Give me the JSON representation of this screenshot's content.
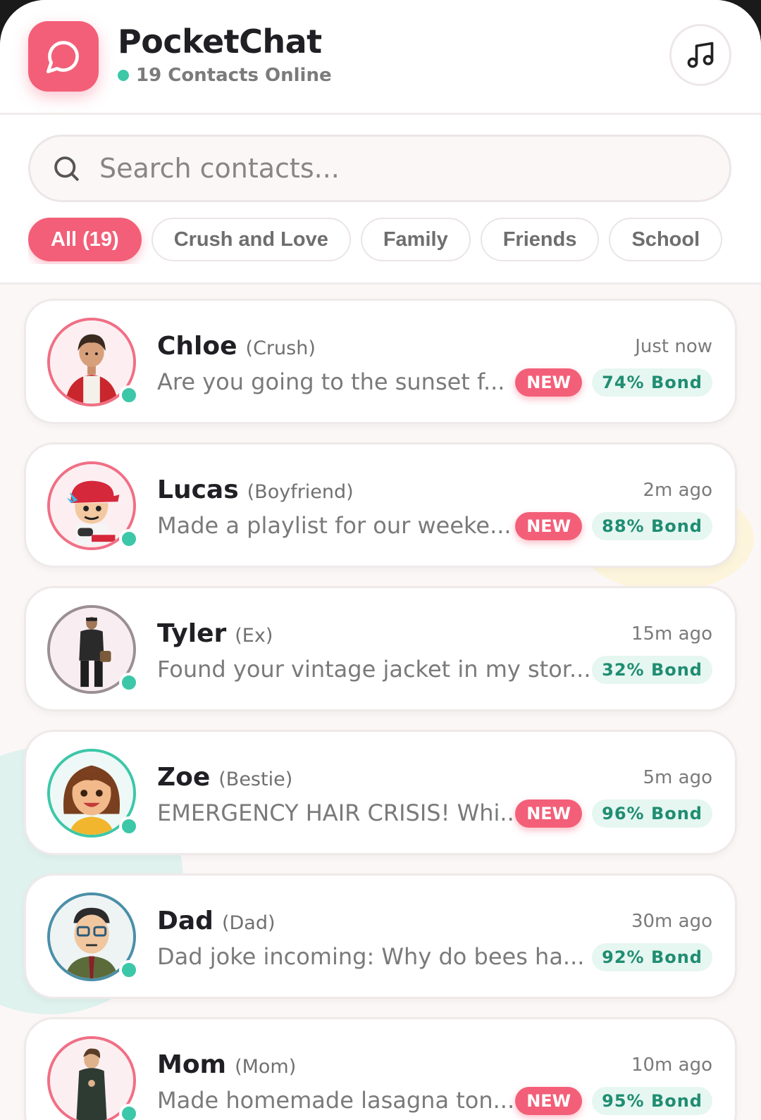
{
  "app": {
    "title": "PocketChat",
    "online_status": "19 Contacts Online"
  },
  "search": {
    "placeholder": "Search contacts..."
  },
  "filters": [
    {
      "label": "All (19)",
      "active": true
    },
    {
      "label": "Crush and Love",
      "active": false
    },
    {
      "label": "Family",
      "active": false
    },
    {
      "label": "Friends",
      "active": false
    },
    {
      "label": "School",
      "active": false
    }
  ],
  "contacts": [
    {
      "name": "Chloe",
      "relation": "(Crush)",
      "time": "Just now",
      "preview": "Are you going to the sunset f...",
      "new_label": "NEW",
      "bond": "74% Bond",
      "online": true,
      "avatar_ring": "#f06f85"
    },
    {
      "name": "Lucas",
      "relation": "(Boyfriend)",
      "time": "2m ago",
      "preview": "Made a playlist for our weeke...",
      "new_label": "NEW",
      "bond": "88% Bond",
      "online": true,
      "avatar_ring": "#f06f85"
    },
    {
      "name": "Tyler",
      "relation": "(Ex)",
      "time": "15m ago",
      "preview": "Found your vintage jacket in my stor...",
      "new_label": "",
      "bond": "32% Bond",
      "online": true,
      "avatar_ring": "#9a8f94"
    },
    {
      "name": "Zoe",
      "relation": "(Bestie)",
      "time": "5m ago",
      "preview": "EMERGENCY HAIR CRISIS! Whi...",
      "new_label": "NEW",
      "bond": "96% Bond",
      "online": true,
      "avatar_ring": "#3cc7a8"
    },
    {
      "name": "Dad",
      "relation": "(Dad)",
      "time": "30m ago",
      "preview": "Dad joke incoming: Why do bees ha...",
      "new_label": "",
      "bond": "92% Bond",
      "online": true,
      "avatar_ring": "#4a8fa8"
    },
    {
      "name": "Mom",
      "relation": "(Mom)",
      "time": "10m ago",
      "preview": "Made homemade lasagna ton...",
      "new_label": "NEW",
      "bond": "95% Bond",
      "online": true,
      "avatar_ring": "#f06f85"
    }
  ],
  "colors": {
    "accent": "#f35f78",
    "online": "#3cc7a8",
    "bond_text": "#208d72",
    "bond_bg": "#e6f6f1"
  }
}
